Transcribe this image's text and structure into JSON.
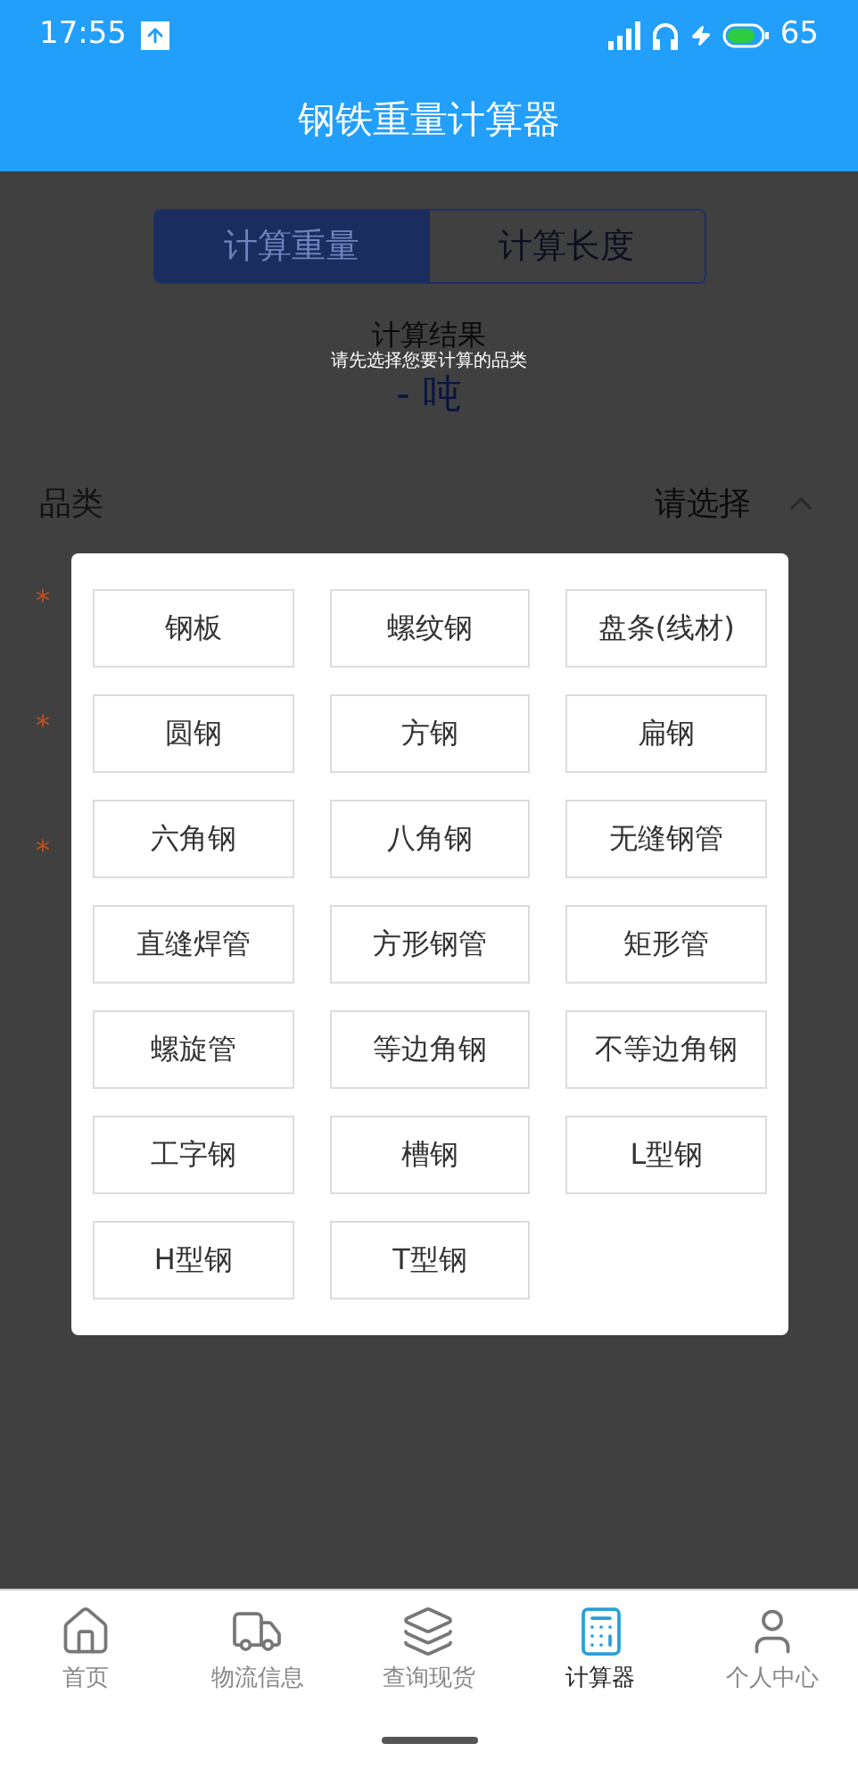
{
  "status_bar": {
    "time": "17:55",
    "battery": "65"
  },
  "header": {
    "title": "钢铁重量计算器"
  },
  "mode_tabs": [
    {
      "label": "计算重量",
      "selected": true
    },
    {
      "label": "计算长度",
      "selected": false
    }
  ],
  "result": {
    "label": "计算结果",
    "value": "- 吨"
  },
  "toast": "请先选择您要计算的品类",
  "category": {
    "label": "品类",
    "placeholder": "请选择",
    "expanded": true
  },
  "field_marks": [
    "*",
    "*",
    "*"
  ],
  "category_options": [
    "钢板",
    "螺纹钢",
    "盘条(线材)",
    "圆钢",
    "方钢",
    "扁钢",
    "六角钢",
    "八角钢",
    "无缝钢管",
    "直缝焊管",
    "方形钢管",
    "矩形管",
    "螺旋管",
    "等边角钢",
    "不等边角钢",
    "工字钢",
    "槽钢",
    "L型钢",
    "H型钢",
    "T型钢"
  ],
  "bottom_nav": [
    {
      "label": "首页",
      "kind": "home",
      "selected": false
    },
    {
      "label": "物流信息",
      "kind": "truck",
      "selected": false
    },
    {
      "label": "查询现货",
      "kind": "stock",
      "selected": false
    },
    {
      "label": "计算器",
      "kind": "calculator",
      "selected": true
    },
    {
      "label": "个人中心",
      "kind": "user",
      "selected": false
    }
  ]
}
